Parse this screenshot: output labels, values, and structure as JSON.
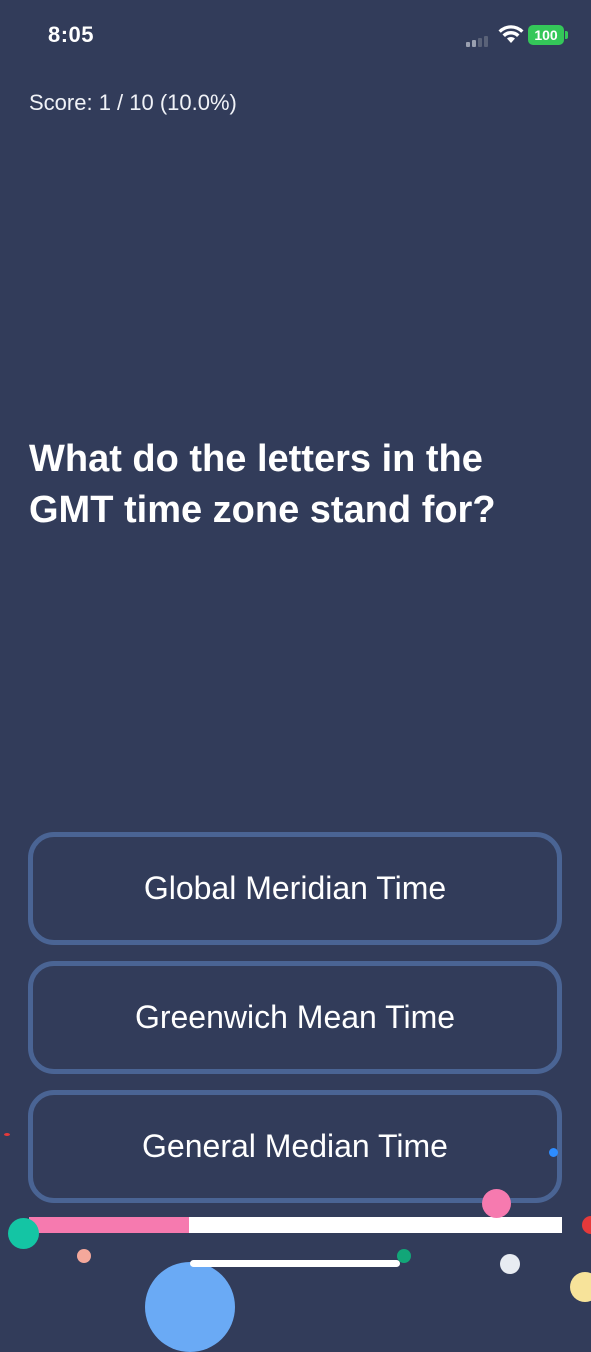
{
  "status_bar": {
    "time": "8:05",
    "battery": "100",
    "colors": {
      "battery": "#34c759"
    }
  },
  "quiz": {
    "score_text": "Score: 1 / 10 (10.0%)",
    "question": "What do the letters in the GMT time zone stand for?",
    "answers": [
      "Global Meridian Time",
      "Greenwich Mean Time",
      "General Median Time"
    ],
    "progress": 0.3
  },
  "colors": {
    "background": "#323c5a",
    "answer_border": "#4a6494",
    "progress_fill": "#f67aaf",
    "progress_track": "#ffffff"
  }
}
